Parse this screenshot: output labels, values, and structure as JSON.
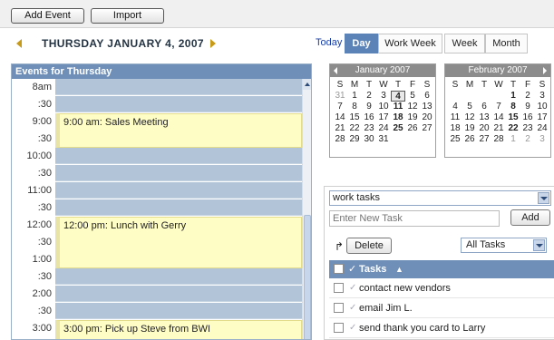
{
  "toolbar": {
    "add_event_label": "Add Event",
    "import_label": "Import"
  },
  "date_header": {
    "title": "THURSDAY JANUARY 4, 2007"
  },
  "views": {
    "today_label": "Today",
    "day": "Day",
    "work_week": "Work Week",
    "week": "Week",
    "month": "Month",
    "active": "Day"
  },
  "calendar": {
    "header": "Events for Thursday",
    "times": [
      "8am",
      ":30",
      "9:00",
      ":30",
      "10:00",
      ":30",
      "11:00",
      ":30",
      "12:00",
      ":30",
      "1:00",
      ":30",
      "2:00",
      ":30",
      "3:00"
    ],
    "events": [
      {
        "label": "9:00 am: Sales Meeting"
      },
      {
        "label": "12:00 pm: Lunch with Gerry"
      },
      {
        "label": "3:00 pm: Pick up Steve from BWI"
      }
    ]
  },
  "mini_calendars": [
    {
      "title": "January 2007",
      "dow": [
        "S",
        "M",
        "T",
        "W",
        "T",
        "F",
        "S"
      ],
      "rows": [
        [
          "31",
          "1",
          "2",
          "3",
          "4",
          "5",
          "6"
        ],
        [
          "7",
          "8",
          "9",
          "10",
          "11",
          "12",
          "13"
        ],
        [
          "14",
          "15",
          "16",
          "17",
          "18",
          "19",
          "20"
        ],
        [
          "21",
          "22",
          "23",
          "24",
          "25",
          "26",
          "27"
        ],
        [
          "28",
          "29",
          "30",
          "31",
          "",
          "",
          ""
        ]
      ]
    },
    {
      "title": "February 2007",
      "dow": [
        "S",
        "M",
        "T",
        "W",
        "T",
        "F",
        "S"
      ],
      "rows": [
        [
          "",
          "",
          "",
          "",
          "1",
          "2",
          "3"
        ],
        [
          "4",
          "5",
          "6",
          "7",
          "8",
          "9",
          "10"
        ],
        [
          "11",
          "12",
          "13",
          "14",
          "15",
          "16",
          "17"
        ],
        [
          "18",
          "19",
          "20",
          "21",
          "22",
          "23",
          "24"
        ],
        [
          "25",
          "26",
          "27",
          "28",
          "1",
          "2",
          "3"
        ]
      ]
    }
  ],
  "tasks": {
    "list_select": "work tasks",
    "new_task_placeholder": "Enter New Task",
    "add_label": "Add",
    "delete_label": "Delete",
    "filter": "All Tasks",
    "header": "Tasks",
    "sort_indicator": "▲",
    "items": [
      "contact new vendors",
      "email Jim L.",
      "send thank you card to Larry"
    ]
  },
  "colors": {
    "accent": "#5b83b7",
    "header_blue": "#6f8fb8",
    "slot_blue": "#b2c4d8",
    "event_yellow": "#fffdc6",
    "arrow_gold": "#c89a1a"
  }
}
